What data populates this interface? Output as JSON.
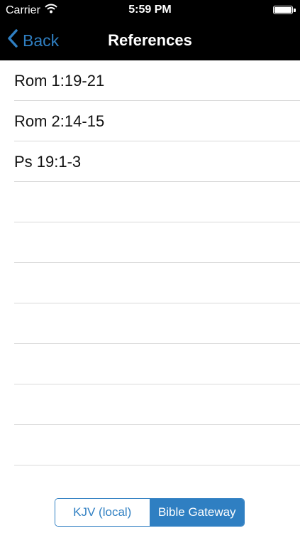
{
  "status_bar": {
    "carrier": "Carrier",
    "time": "5:59 PM"
  },
  "nav": {
    "back_label": "Back",
    "title": "References"
  },
  "references": [
    "Rom 1:19-21",
    "Rom 2:14-15",
    "Ps 19:1-3",
    "",
    "",
    "",
    "",
    "",
    "",
    ""
  ],
  "segmented": {
    "options": [
      "KJV (local)",
      "Bible Gateway"
    ],
    "selected": "Bible Gateway"
  },
  "colors": {
    "accent": "#2f7fc2",
    "bar_background": "#000000",
    "separator": "#d9d9d9"
  }
}
